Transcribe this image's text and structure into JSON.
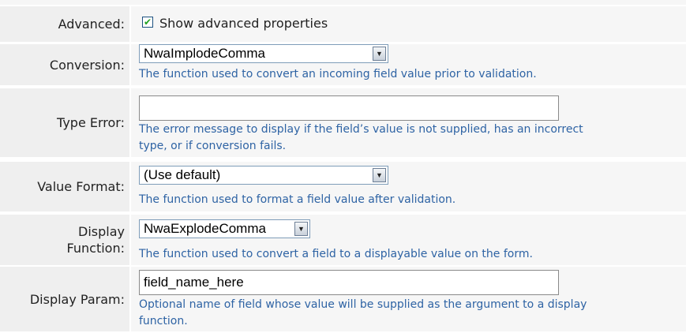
{
  "advanced": {
    "label": "Advanced:",
    "checkbox_checked": true,
    "checkbox_label": "Show advanced properties"
  },
  "conversion": {
    "label": "Conversion:",
    "selected": "NwaImplodeComma",
    "help": "The function used to convert an incoming field value prior to validation."
  },
  "type_error": {
    "label": "Type Error:",
    "value": "",
    "help_line1": "The error message to display if the field’s value is not supplied, has an incorrect",
    "help_line2": "type, or if conversion fails."
  },
  "value_format": {
    "label": "Value Format:",
    "selected": "(Use default)",
    "help": "The function used to format a field value after validation."
  },
  "display_function": {
    "label_line1": "Display",
    "label_line2": "Function:",
    "selected": "NwaExplodeComma",
    "help": "The function used to convert a field to a displayable value on the form."
  },
  "display_param": {
    "label": "Display Param:",
    "value": "field_name_here",
    "help_line1": "Optional name of field whose value will be supplied as the argument to a display",
    "help_line2": "function."
  },
  "icons": {
    "checkbox": "checkmark-icon",
    "dropdown": "chevron-down-icon"
  }
}
